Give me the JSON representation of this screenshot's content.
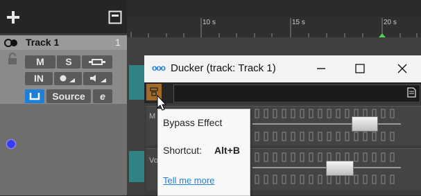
{
  "toolbar": {
    "add_icon": "plus-icon",
    "collapse_icon": "panel-toggle-icon"
  },
  "track": {
    "name": "Track 1",
    "number": "1",
    "buttons": {
      "mute": "M",
      "solo": "S",
      "input": "IN",
      "source": "Source",
      "edit": "e"
    },
    "color_dot": "#3b3bff"
  },
  "ruler": {
    "ticks": [
      "10 s",
      "15 s",
      "20 s"
    ]
  },
  "plugin": {
    "title": "Ducker (track: Track 1)",
    "title_icon": "ooo",
    "minimize": "—",
    "maximize": "☐",
    "close": "✕",
    "param_labels": [
      "M",
      "Vo"
    ]
  },
  "tooltip": {
    "title": "Bypass Effect",
    "shortcut_label": "Shortcut:",
    "shortcut_value": "Alt+B",
    "link": "Tell me more"
  },
  "colors": {
    "accent": "#1e7fd8",
    "bypass": "#a36b2a",
    "waveform": "#2f8f8f"
  }
}
